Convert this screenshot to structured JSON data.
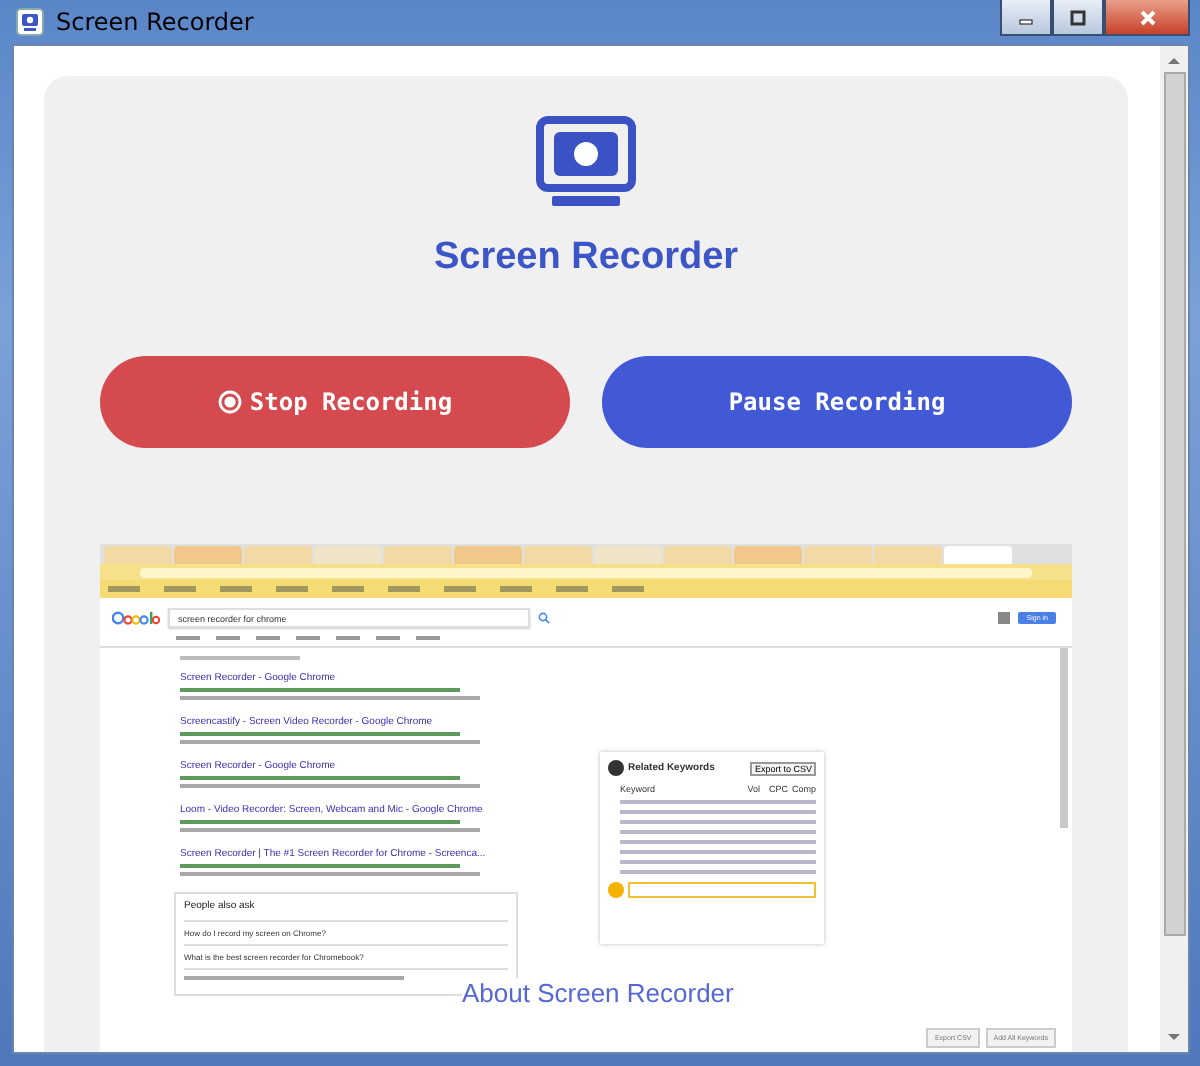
{
  "window": {
    "title": "Screen Recorder"
  },
  "app": {
    "title": "Screen Recorder",
    "buttons": [
      {
        "kind": "stop",
        "label": "Stop Recording"
      },
      {
        "kind": "pause",
        "label": "Pause Recording"
      }
    ]
  },
  "preview": {
    "search_query": "screen recorder for chrome",
    "sign_in": "Sign in",
    "results": [
      {
        "title": "Screen Recorder - Google Chrome"
      },
      {
        "title": "Screencastify - Screen Video Recorder - Google Chrome"
      },
      {
        "title": "Screen Recorder - Google Chrome"
      },
      {
        "title": "Loom - Video Recorder: Screen, Webcam and Mic - Google Chrome"
      },
      {
        "title": "Screen Recorder | The #1 Screen Recorder for Chrome - Screenca..."
      }
    ],
    "keywords_panel": {
      "title": "Related Keywords",
      "export": "Export to CSV",
      "columns": [
        "Keyword",
        "Vol",
        "CPC",
        "Comp"
      ]
    },
    "people_also_ask": {
      "title": "People also ask",
      "questions": [
        "How do I record my screen on Chrome?",
        "What is the best screen recorder for Chromebook?"
      ]
    },
    "footer_buttons": [
      "Export CSV",
      "Add All Keywords"
    ]
  },
  "section_heading": "About Screen Recorder"
}
